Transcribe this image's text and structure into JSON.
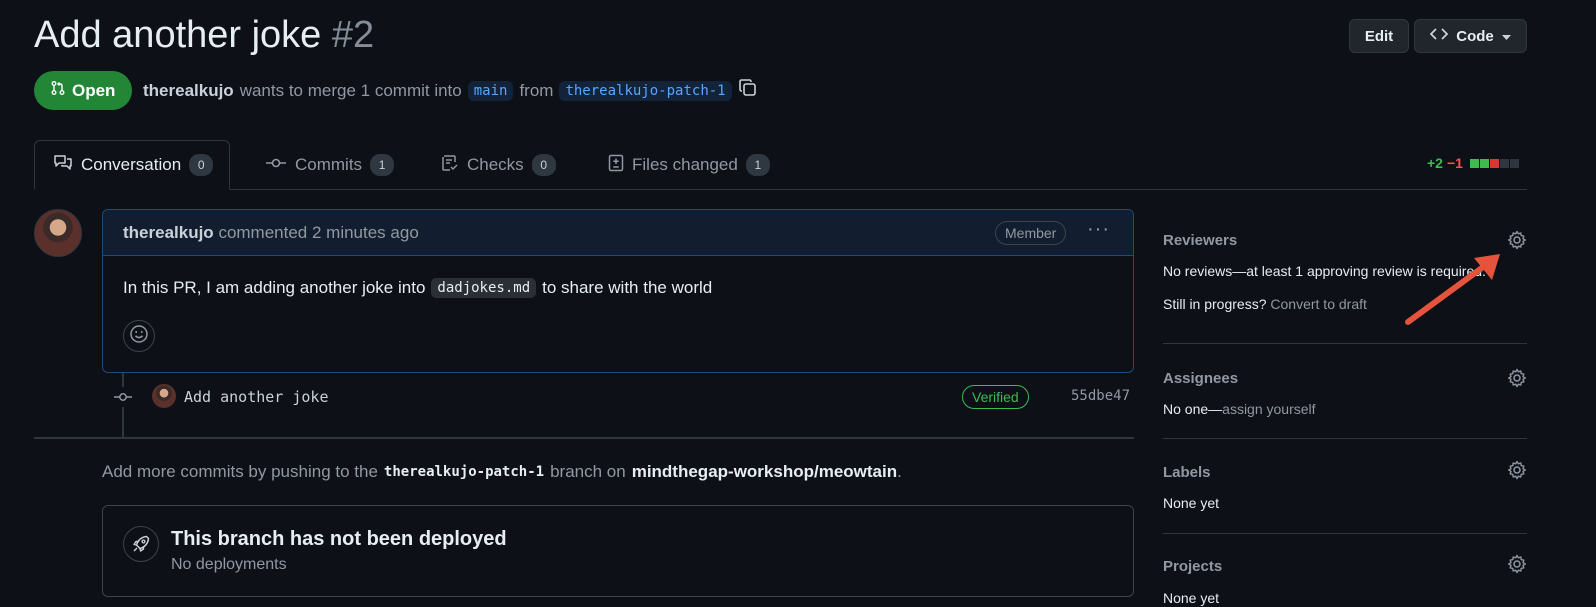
{
  "header": {
    "title": "Add another joke",
    "number": "#2",
    "edit_label": "Edit",
    "code_label": "Code"
  },
  "pr_meta": {
    "state": "Open",
    "author": "therealkujo",
    "text1": "wants to merge 1 commit into",
    "base_branch": "main",
    "text2": "from",
    "head_branch": "therealkujo-patch-1"
  },
  "tabs": [
    {
      "label": "Conversation",
      "count": "0"
    },
    {
      "label": "Commits",
      "count": "1"
    },
    {
      "label": "Checks",
      "count": "0"
    },
    {
      "label": "Files changed",
      "count": "1"
    }
  ],
  "diffstat": {
    "additions": "+2",
    "deletions": "−1"
  },
  "comment": {
    "author": "therealkujo",
    "action": "commented 2 minutes ago",
    "badge": "Member",
    "menu": "···",
    "body_before": "In this PR, I am adding another joke into",
    "body_code": "dadjokes.md",
    "body_after": "to share with the world"
  },
  "commit": {
    "message": "Add another joke",
    "verified": "Verified",
    "sha": "55dbe47"
  },
  "push_hint": {
    "before": "Add more commits by pushing to the",
    "branch": "therealkujo-patch-1",
    "middle": "branch on",
    "repo": "mindthegap-workshop/meowtain",
    "end": "."
  },
  "deploy": {
    "title": "This branch has not been deployed",
    "subtitle": "No deployments"
  },
  "sidebar": {
    "reviewers": {
      "title": "Reviewers",
      "text": "No reviews—at least 1 approving review is required.",
      "progress_label": "Still in progress?",
      "progress_link": "Convert to draft"
    },
    "assignees": {
      "title": "Assignees",
      "text": "No one—",
      "link": "assign yourself"
    },
    "labels": {
      "title": "Labels",
      "text": "None yet"
    },
    "projects": {
      "title": "Projects",
      "text": "None yet"
    }
  },
  "colors": {
    "accent_green": "#238636",
    "link_blue": "#58a6ff",
    "annotation_arrow": "#e5533d"
  }
}
